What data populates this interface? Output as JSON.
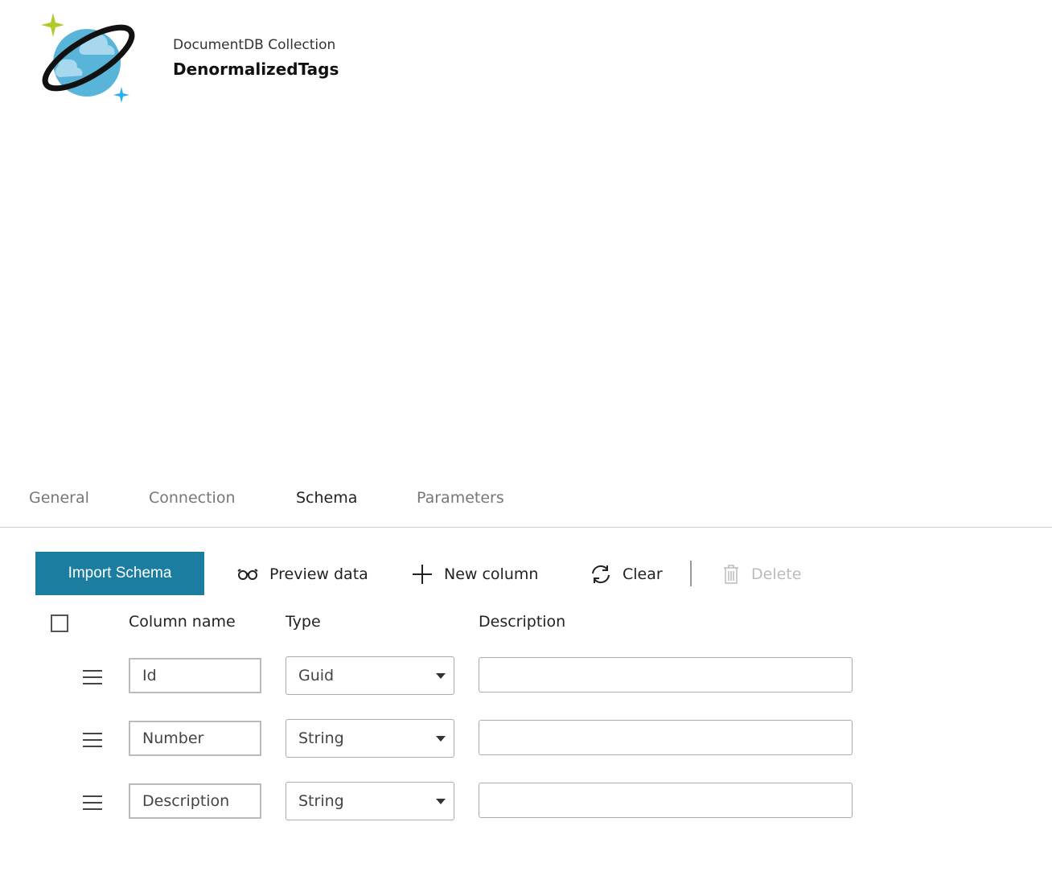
{
  "header": {
    "subtitle": "DocumentDB Collection",
    "title": "DenormalizedTags",
    "logo_icon": "cosmos-db-planet-icon"
  },
  "tabs": [
    {
      "label": "General"
    },
    {
      "label": "Connection"
    },
    {
      "label": "Schema",
      "active": true
    },
    {
      "label": "Parameters"
    }
  ],
  "toolbar": {
    "import_label": "Import Schema",
    "preview_label": "Preview data",
    "new_column_label": "New column",
    "clear_label": "Clear",
    "delete_label": "Delete",
    "accent": "#1b7ea1"
  },
  "table": {
    "headers": {
      "name": "Column name",
      "type": "Type",
      "description": "Description"
    },
    "rows": [
      {
        "name": "Id",
        "type": "Guid",
        "description": ""
      },
      {
        "name": "Number",
        "type": "String",
        "description": ""
      },
      {
        "name": "Description",
        "type": "String",
        "description": ""
      }
    ]
  }
}
